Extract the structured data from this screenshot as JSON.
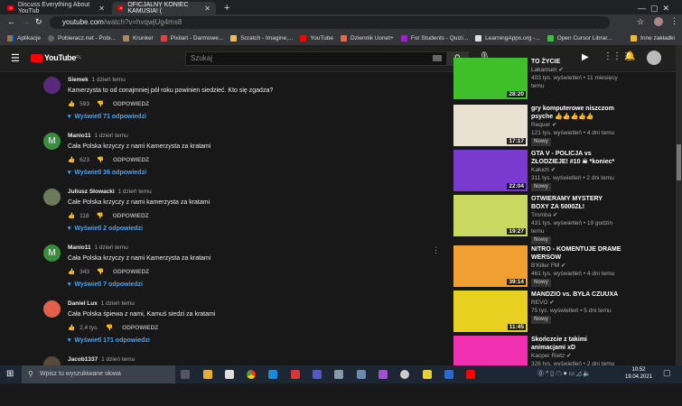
{
  "browser": {
    "tabs": [
      {
        "title": "Discuss Everything About YouTub"
      },
      {
        "title": "OFICJALNY KONIEC KAMUSIA! (",
        "active": true
      }
    ],
    "url_host": "youtube.com",
    "url_path": "/watch?v=hvqwjUg4ms8",
    "bookmarks": [
      "Aplikacje",
      "Pobieracz.net - Pobi...",
      "Krunker",
      "Pixilart - Darmowe...",
      "Scratch - Imagine,...",
      "YouTube",
      "Dziennik Uonet+",
      "For Students - Quizi...",
      "LearningApps.org -...",
      "Open Cursor Librar..."
    ],
    "other_bookmarks": "Inne zakładki"
  },
  "youtube": {
    "logo": "YouTube",
    "region": "PL",
    "search_placeholder": "Szukaj"
  },
  "comments": [
    {
      "author": "Siemek",
      "time": "1 dzień temu",
      "text": "Kamerzysta to od conajmniej pół roku powinien siedzieć. Kto się zgadza?",
      "likes": "593",
      "reply": "ODPOWIEDZ",
      "replies": "Wyświetl 71 odpowiedzi",
      "avatar_color": "#5a2a7a",
      "initial": ""
    },
    {
      "author": "Manio11",
      "time": "1 dzień temu",
      "text": "Cała Polska krzyczy z nami Kamerzysta za kratami",
      "likes": "623",
      "reply": "ODPOWIEDZ",
      "replies": "Wyświetl 36 odpowiedzi",
      "avatar_color": "#388e3c",
      "initial": "M"
    },
    {
      "author": "Juliusz Słowacki",
      "time": "1 dzień temu",
      "text": "Całe Polska krzyczy z nami kamerzysta za kratami",
      "likes": "118",
      "reply": "ODPOWIEDZ",
      "replies": "Wyświetl 2 odpowiedzi",
      "avatar_color": "#6b7a5a",
      "initial": ""
    },
    {
      "author": "Manio11",
      "time": "1 dzień temu",
      "text": "Cała Polska krzyczy z nami Kamerzysta za kratami",
      "likes": "343",
      "reply": "ODPOWIEDZ",
      "replies": "Wyświetl 7 odpowiedzi",
      "avatar_color": "#388e3c",
      "initial": "M"
    },
    {
      "author": "Daniel Lux",
      "time": "1 dzień temu",
      "text": "Cała Polska śpiewa z nami, Kamuś siedzi za kratami",
      "likes": "2,4 tys.",
      "reply": "ODPOWIEDZ",
      "replies": "Wyświetl 171 odpowiedzi",
      "avatar_color": "#e0604a",
      "initial": ""
    },
    {
      "author": "Jacob1337",
      "time": "1 dzień temu",
      "avatar_color": "#5a4a3a",
      "initial": ""
    }
  ],
  "videos": [
    {
      "title": "TO ŻYCIE",
      "channel": "Lakamum",
      "views": "403 tys. wyświetleń",
      "age": "11 miesięcy temu",
      "duration": "28:20",
      "new": "",
      "thumb": "#3fbf2a"
    },
    {
      "title": "gry komputerowe niszczom psyche 👍👍👍👍👍",
      "channel": "Requer",
      "views": "121 tys. wyświetleń",
      "age": "4 dni temu",
      "duration": "17:17",
      "new": "Nowy",
      "thumb": "#e8e0d0"
    },
    {
      "title": "GTA V - POLICJA vs ZŁODZIEJE! #10 ☠ *koniec*",
      "channel": "Kałuch",
      "views": "311 tys. wyświetleń",
      "age": "2 dni temu",
      "duration": "22:04",
      "new": "Nowy",
      "thumb": "#7a3ad0"
    },
    {
      "title": "OTWIERAMY MYSTERY BOXY ZA 5000ZŁ!",
      "channel": "Tromba",
      "views": "431 tys. wyświetleń",
      "age": "19 godzin temu",
      "duration": "19:27",
      "new": "Nowy",
      "thumb": "#c8d860"
    },
    {
      "title": "NITRO - KOMENTUJE DRAME WERSOW",
      "channel": "B'Killer FM",
      "views": "461 tys. wyświetleń",
      "age": "4 dni temu",
      "duration": "39:14",
      "new": "Nowy",
      "thumb": "#f0a030"
    },
    {
      "title": "MANDZIO vs. BYŁA CZUUXA",
      "channel": "REVO",
      "views": "75 tys. wyświetleń",
      "age": "5 dni temu",
      "duration": "11:45",
      "new": "Nowy",
      "thumb": "#e8d020"
    },
    {
      "title": "Skończcie z takimi animacjami xD",
      "channel": "Kacper Rietz",
      "views": "326 tys. wyświetleń",
      "age": "2 dni temu",
      "duration": "",
      "new": "",
      "thumb": "#f030b0"
    }
  ],
  "taskbar": {
    "search_placeholder": "Wpisz tu wyszukiwane słowa",
    "time": "10:52",
    "date": "19.04.2021"
  }
}
